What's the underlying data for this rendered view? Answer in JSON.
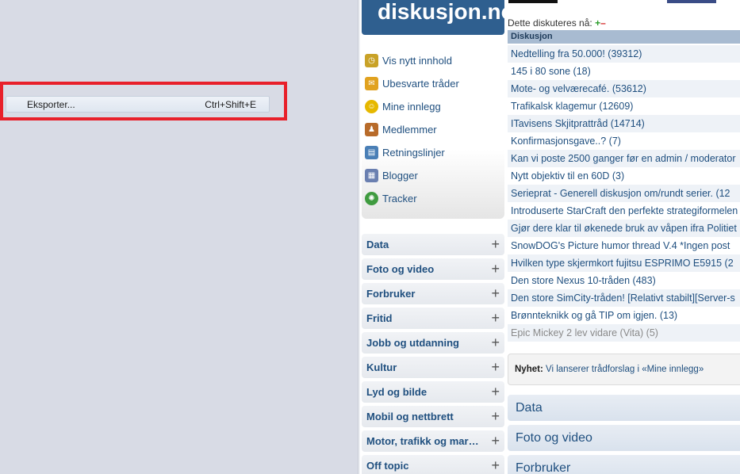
{
  "context_menu": {
    "item_label": "Eksporter...",
    "item_shortcut": "Ctrl+Shift+E"
  },
  "site": {
    "logo_text": "diskusjon.no"
  },
  "nav": [
    {
      "label": "Vis nytt innhold",
      "icon": "clock-icon"
    },
    {
      "label": "Ubesvarte tråder",
      "icon": "envelope-icon"
    },
    {
      "label": "Mine innlegg",
      "icon": "smiley-icon"
    },
    {
      "label": "Medlemmer",
      "icon": "members-icon"
    },
    {
      "label": "Retningslinjer",
      "icon": "guidelines-icon"
    },
    {
      "label": "Blogger",
      "icon": "blog-icon"
    },
    {
      "label": "Tracker",
      "icon": "bug-icon"
    }
  ],
  "categories": [
    "Data",
    "Foto og video",
    "Forbruker",
    "Fritid",
    "Jobb og utdanning",
    "Kultur",
    "Lyd og bilde",
    "Mobil og nettbrett",
    "Motor, trafikk og mar…",
    "Off topic"
  ],
  "discussion": {
    "heading": "Dette diskuteres nå:",
    "plus": "+",
    "minus": "–",
    "column_header": "Diskusjon",
    "threads": [
      "Nedtelling fra 50.000! (39312)",
      "145 i 80 sone (18)",
      "Mote- og velværecafé. (53612)",
      "Trafikalsk klagemur (12609)",
      "ITavisens Skjitprattråd (14714)",
      "Konfirmasjonsgave..? (7)",
      "Kan vi poste 2500 ganger før en admin / moderator",
      "Nytt objektiv til en 60D (3)",
      "Serieprat - Generell diskusjon om/rundt serier. (12",
      "Introduserte StarCraft den perfekte strategiformelen",
      "Gjør dere klar til økenede bruk av våpen ifra Politiet",
      "SnowDOG's Picture humor thread V.4 *Ingen post",
      "Hvilken type skjermkort fujitsu ESPRIMO E5915 (2",
      "Den store Nexus 10-tråden (483)",
      "Den store SimCity-tråden! [Relativt stabilt][Server-s",
      "Brønnteknikk og gå TIP om igjen. (13)",
      "Epic Mickey 2 lev vidare (Vita) (5)"
    ]
  },
  "news": {
    "label": "Nyhet:",
    "text": " Vi lanserer trådforslag i «Mine innlegg»"
  },
  "categories_main": [
    "Data",
    "Foto og video",
    "Forbruker"
  ]
}
